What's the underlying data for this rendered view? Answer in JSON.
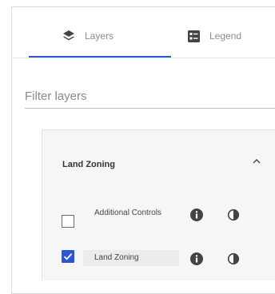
{
  "tabs": [
    {
      "label": "Layers",
      "icon": "layers-icon",
      "active": true
    },
    {
      "label": "Legend",
      "icon": "legend-icon",
      "active": false
    }
  ],
  "filter": {
    "placeholder": "Filter layers",
    "value": ""
  },
  "group": {
    "title": "Land Zoning",
    "expanded": true,
    "layers": [
      {
        "label": "Additional Controls",
        "checked": false
      },
      {
        "label": "Land Zoning",
        "checked": true
      }
    ]
  },
  "colors": {
    "accent": "#2b56d4"
  }
}
